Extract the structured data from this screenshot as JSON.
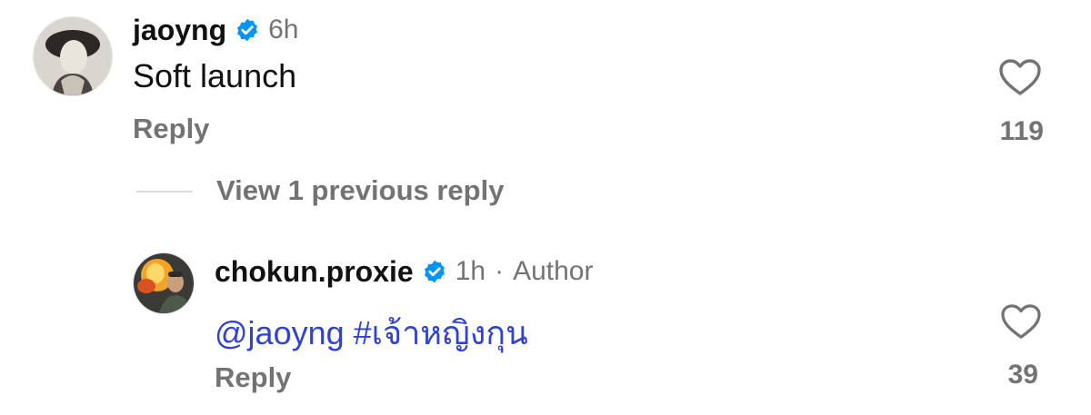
{
  "comments": [
    {
      "username": "jaoyng",
      "verified": true,
      "time": "6h",
      "text": "Soft launch",
      "reply_label": "Reply",
      "like_count": "119"
    }
  ],
  "view_replies_label": "View 1 previous reply",
  "reply": {
    "username": "chokun.proxie",
    "verified": true,
    "time": "1h",
    "separator": "·",
    "author_label": "Author",
    "mention": "@jaoyng",
    "hashtag": "#เจ้าหญิงกุน",
    "reply_label": "Reply",
    "like_count": "39"
  },
  "colors": {
    "verified_blue": "#0095f6",
    "link_blue": "#3042d6",
    "muted_gray": "#737373"
  }
}
